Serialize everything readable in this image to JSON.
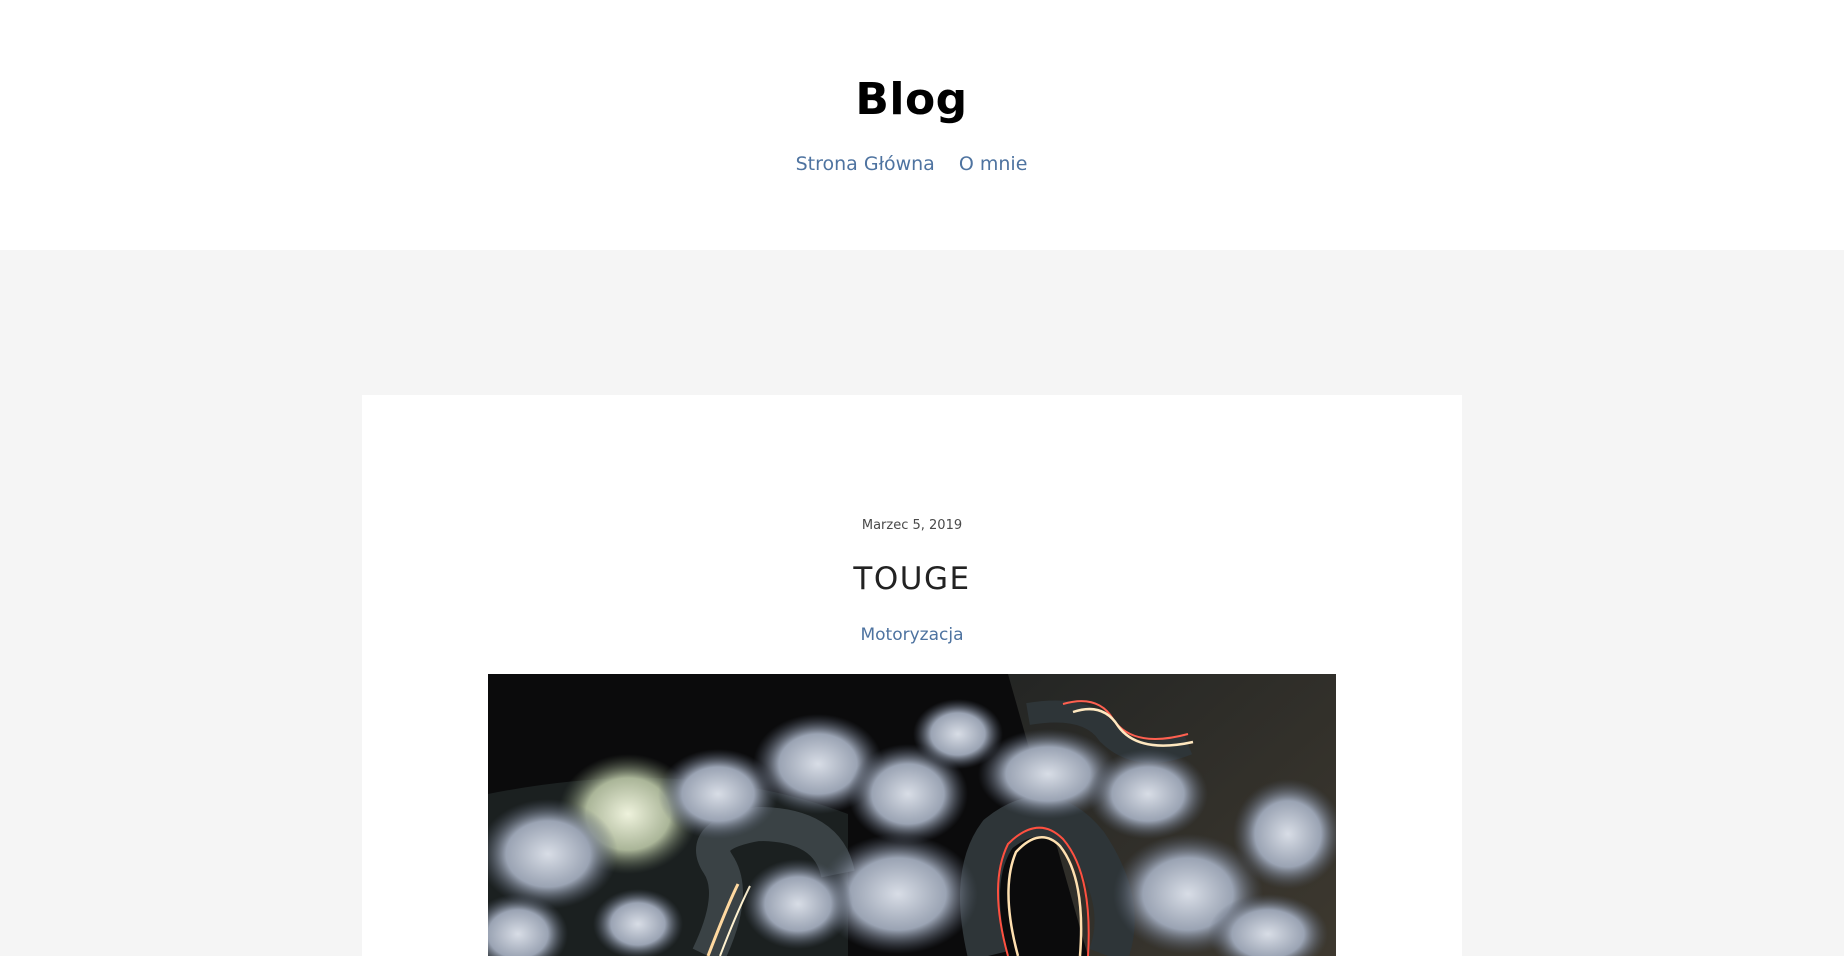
{
  "header": {
    "title": "Blog",
    "nav": [
      {
        "label": "Strona Główna"
      },
      {
        "label": "O mnie"
      }
    ]
  },
  "post": {
    "date": "Marzec 5, 2019",
    "title": "TOUGE",
    "category": "Motoryzacja",
    "image_alt": "Night mountain road with cherry blossom trees and light trails"
  },
  "colors": {
    "page_bg": "#f5f5f5",
    "header_bg": "#ffffff",
    "link": "#4e73a0",
    "title": "#000000",
    "card_bg": "#ffffff"
  }
}
